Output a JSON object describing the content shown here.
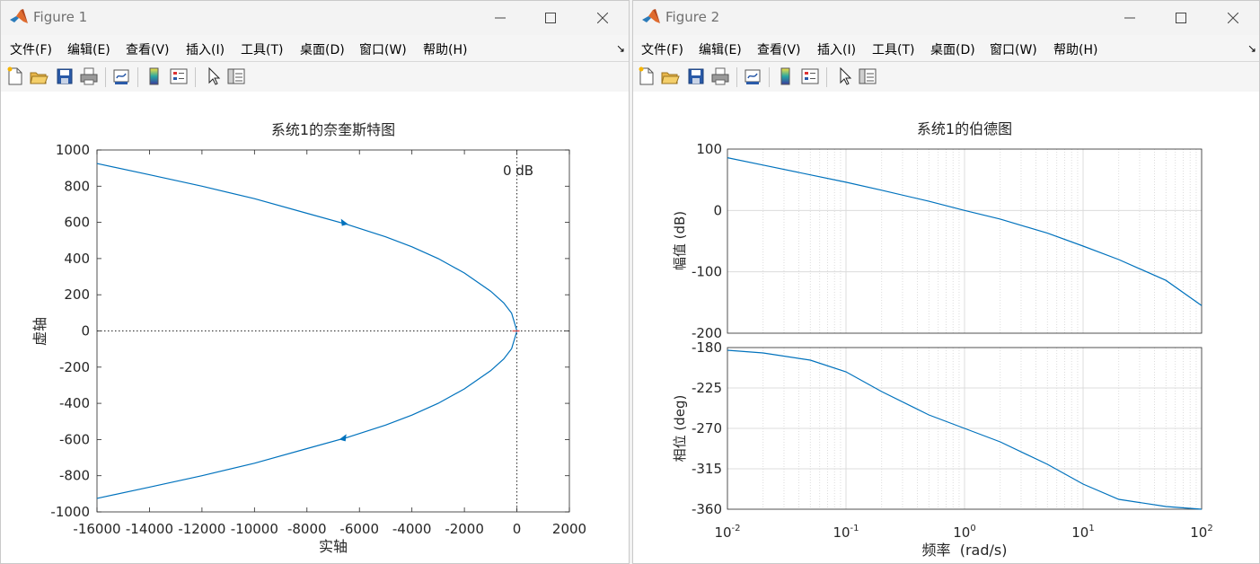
{
  "windows": [
    {
      "title": "Figure 1",
      "menu": [
        "文件(F)",
        "编辑(E)",
        "查看(V)",
        "插入(I)",
        "工具(T)",
        "桌面(D)",
        "窗口(W)",
        "帮助(H)"
      ],
      "plot": {
        "title": "系统1的奈奎斯特图",
        "xlabel": "实轴",
        "ylabel": "虚轴",
        "annotation": "0 dB",
        "xticks": [
          "-16000",
          "-14000",
          "-12000",
          "-10000",
          "-8000",
          "-6000",
          "-4000",
          "-2000",
          "0",
          "2000"
        ],
        "yticks": [
          "1000",
          "800",
          "600",
          "400",
          "200",
          "0",
          "-200",
          "-400",
          "-600",
          "-800",
          "-1000"
        ]
      }
    },
    {
      "title": "Figure 2",
      "menu": [
        "文件(F)",
        "编辑(E)",
        "查看(V)",
        "插入(I)",
        "工具(T)",
        "桌面(D)",
        "窗口(W)",
        "帮助(H)"
      ],
      "plot": {
        "title": "系统1的伯德图",
        "mag_ylabel": "幅值 (dB)",
        "phase_ylabel": "相位 (deg)",
        "xlabel": "频率  (rad/s)",
        "mag_yticks": [
          "100",
          "0",
          "-100",
          "-200"
        ],
        "phase_yticks": [
          "-180",
          "-225",
          "-270",
          "-315",
          "-360"
        ],
        "xtick_exponents": [
          "-2",
          "-1",
          "0",
          "1",
          "2"
        ]
      }
    }
  ],
  "icons": {
    "window_buttons": [
      "minimize-icon",
      "maximize-icon",
      "close-icon"
    ],
    "toolbar": [
      "new-figure-icon",
      "open-file-icon",
      "save-icon",
      "print-icon",
      "link-plot-icon",
      "insert-colorbar-icon",
      "insert-legend-icon",
      "edit-plot-pointer-icon",
      "property-inspector-icon"
    ]
  },
  "colors": {
    "curve": "#0072BD",
    "grid": "#d9d9d9",
    "zero_marker": "#d9534f"
  },
  "chart_data": [
    {
      "type": "line",
      "title": "系统1的奈奎斯特图",
      "xlabel": "实轴",
      "ylabel": "虚轴",
      "xlim": [
        -16000,
        2000
      ],
      "ylim": [
        -1000,
        1000
      ],
      "x_major_ticks": [
        -16000,
        -14000,
        -12000,
        -10000,
        -8000,
        -6000,
        -4000,
        -2000,
        0,
        2000
      ],
      "y_major_ticks": [
        1000,
        800,
        600,
        400,
        200,
        0,
        -200,
        -400,
        -600,
        -800,
        -1000
      ],
      "series": [
        {
          "name": "",
          "points": [
            [
              -16000,
              925
            ],
            [
              -14000,
              863
            ],
            [
              -12000,
              800
            ],
            [
              -10000,
              731
            ],
            [
              -8000,
              650
            ],
            [
              -6500,
              590
            ],
            [
              -5000,
              520
            ],
            [
              -4000,
              465
            ],
            [
              -3000,
              400
            ],
            [
              -2000,
              320
            ],
            [
              -1000,
              220
            ],
            [
              -500,
              155
            ],
            [
              -200,
              98
            ],
            [
              0,
              0
            ],
            [
              -200,
              -98
            ],
            [
              -500,
              -155
            ],
            [
              -1000,
              -220
            ],
            [
              -2000,
              -320
            ],
            [
              -3000,
              -400
            ],
            [
              -4000,
              -465
            ],
            [
              -5000,
              -520
            ],
            [
              -6500,
              -590
            ],
            [
              -8000,
              -650
            ],
            [
              -10000,
              -731
            ],
            [
              -12000,
              -800
            ],
            [
              -14000,
              -863
            ],
            [
              -16000,
              -925
            ]
          ]
        }
      ],
      "direction_arrows": [
        [
          -6600,
          600
        ],
        [
          -6600,
          -590
        ]
      ],
      "annotations": [
        {
          "text": "0 dB",
          "x": 0
        }
      ],
      "grid": false
    },
    {
      "type": "line",
      "title": "系统1的伯德图",
      "xscale": "log",
      "xlim": [
        0.01,
        100
      ],
      "xlabel": "频率  (rad/s)",
      "grid": true,
      "subplots": [
        {
          "ylabel": "幅值 (dB)",
          "ylim": [
            -200,
            100
          ],
          "y_major_ticks": [
            100,
            0,
            -100,
            -200
          ],
          "series": [
            {
              "name": "",
              "points": [
                [
                  0.01,
                  86
                ],
                [
                  0.02,
                  74
                ],
                [
                  0.05,
                  58
                ],
                [
                  0.1,
                  46
                ],
                [
                  0.2,
                  33
                ],
                [
                  0.5,
                  15
                ],
                [
                  1,
                  0
                ],
                [
                  2,
                  -14
                ],
                [
                  5,
                  -37
                ],
                [
                  10,
                  -58
                ],
                [
                  20,
                  -80
                ],
                [
                  50,
                  -114
                ],
                [
                  100,
                  -155
                ]
              ]
            }
          ]
        },
        {
          "ylabel": "相位 (deg)",
          "ylim": [
            -360,
            -180
          ],
          "y_major_ticks": [
            -180,
            -225,
            -270,
            -315,
            -360
          ],
          "series": [
            {
              "name": "",
              "points": [
                [
                  0.01,
                  -183
                ],
                [
                  0.02,
                  -186
                ],
                [
                  0.05,
                  -194
                ],
                [
                  0.1,
                  -207
                ],
                [
                  0.2,
                  -229
                ],
                [
                  0.5,
                  -255
                ],
                [
                  1,
                  -270
                ],
                [
                  2,
                  -285
                ],
                [
                  5,
                  -310
                ],
                [
                  10,
                  -332
                ],
                [
                  20,
                  -349
                ],
                [
                  50,
                  -357
                ],
                [
                  100,
                  -360
                ]
              ]
            }
          ]
        }
      ]
    }
  ]
}
